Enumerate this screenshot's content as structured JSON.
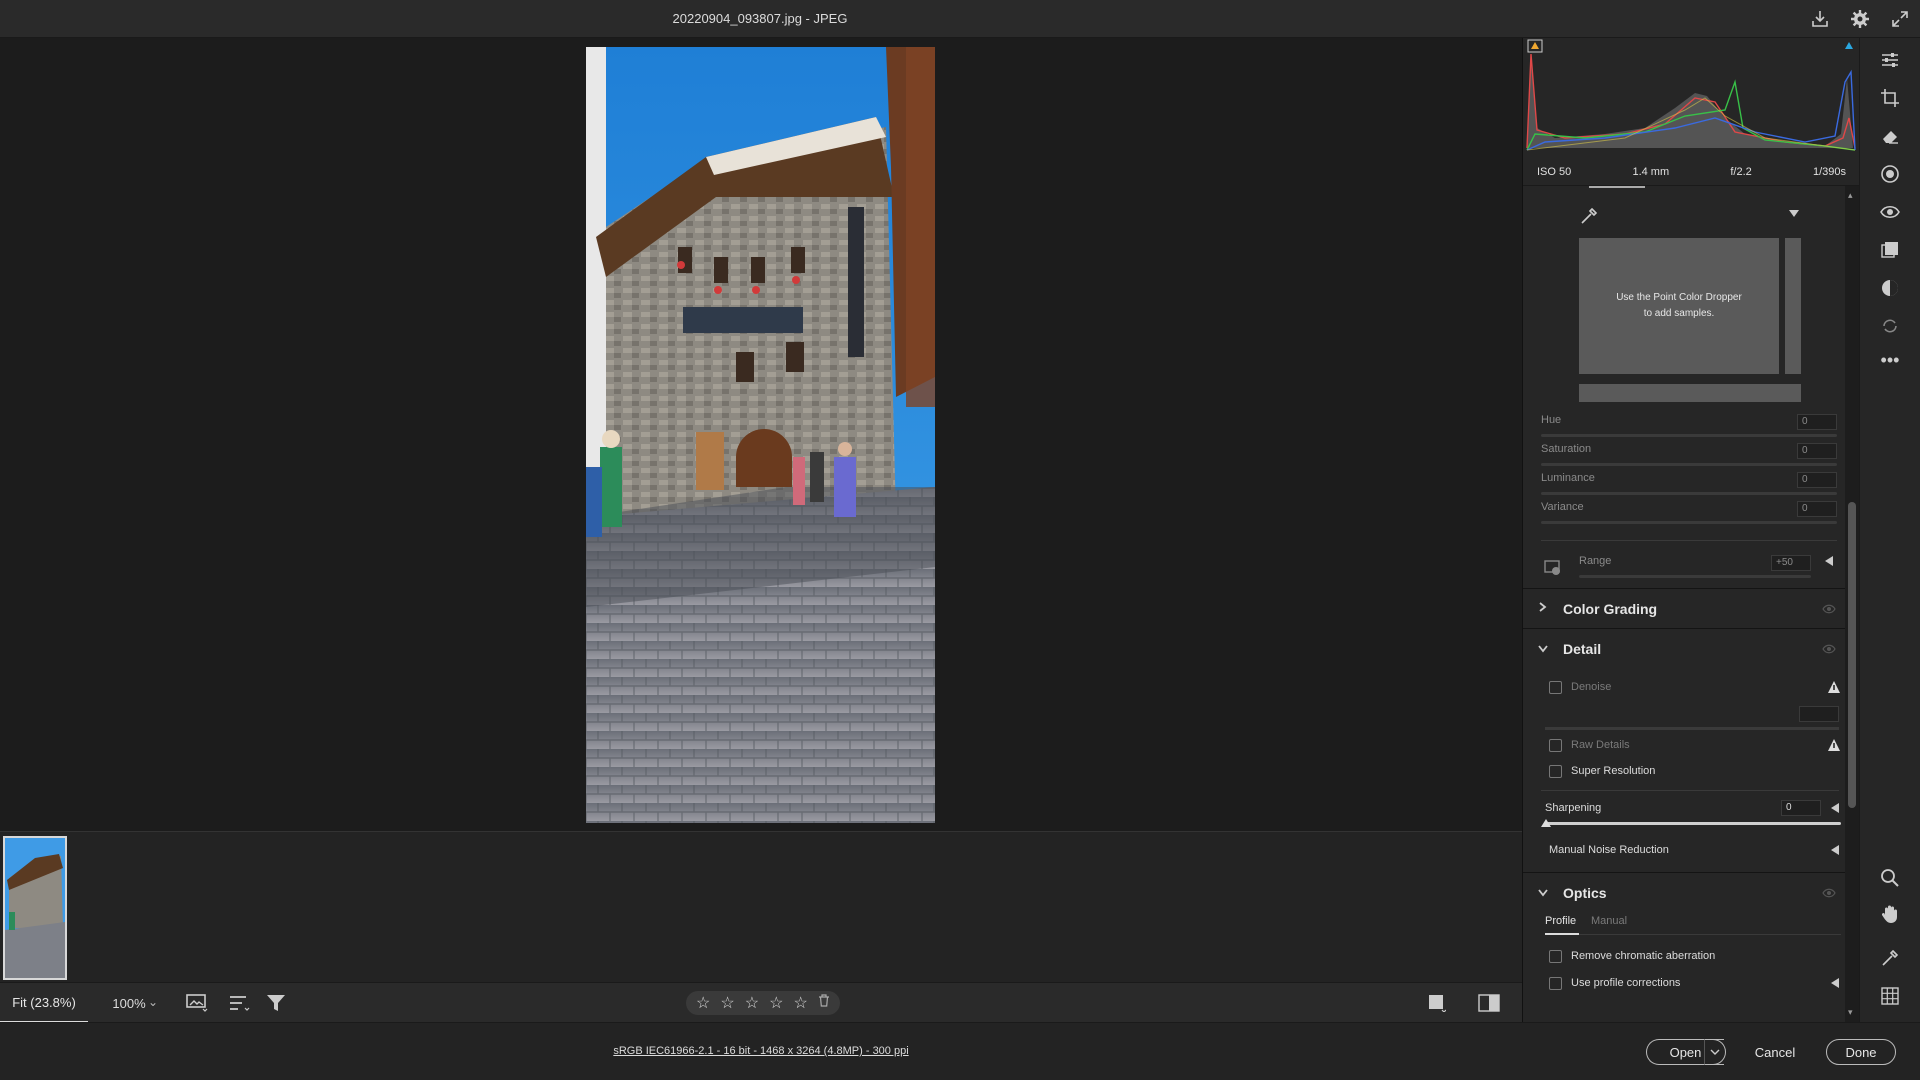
{
  "window": {
    "title": "20220904_093807.jpg  -  JPEG"
  },
  "top_icons": [
    "save-icon",
    "settings-icon",
    "fullscreen-icon"
  ],
  "histogram": {
    "exif": {
      "iso": "ISO 50",
      "focal_length": "1.4 mm",
      "aperture": "f/2.2",
      "shutter": "1/390s"
    }
  },
  "point_color": {
    "message_line1": "Use the Point Color Dropper",
    "message_line2": "to add samples.",
    "sliders": [
      {
        "label": "Hue",
        "value": "0"
      },
      {
        "label": "Saturation",
        "value": "0"
      },
      {
        "label": "Luminance",
        "value": "0"
      },
      {
        "label": "Variance",
        "value": "0"
      }
    ],
    "range_label": "Range",
    "range_value": "+50"
  },
  "sections": {
    "color_grading": "Color Grading",
    "detail": "Detail",
    "optics": "Optics"
  },
  "detail": {
    "denoise": "Denoise",
    "raw_details": "Raw Details",
    "super_resolution": "Super Resolution",
    "sharpening_label": "Sharpening",
    "sharpening_value": "0",
    "manual_noise_reduction": "Manual Noise Reduction"
  },
  "optics": {
    "tab_profile": "Profile",
    "tab_manual": "Manual",
    "remove_chromatic": "Remove chromatic aberration",
    "use_profile": "Use profile corrections"
  },
  "bottombar": {
    "zoom_fit": "Fit (23.8%)",
    "zoom_100": "100%",
    "rating_stars": 0
  },
  "footer": {
    "file_info": "sRGB IEC61966-2.1 - 16 bit - 1468 x 3264 (4.8MP) - 300 ppi",
    "open_label": "Open",
    "cancel_label": "Cancel",
    "done_label": "Done"
  },
  "colors": {
    "accent": "#2aa7e0",
    "panel_bg": "#262626",
    "canvas_bg": "#1c1c1c"
  }
}
